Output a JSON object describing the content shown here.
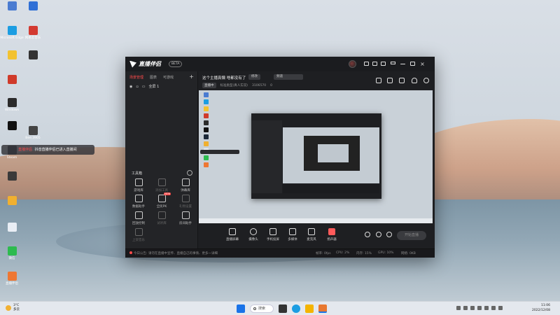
{
  "desktop": {
    "icons": [
      {
        "label": "",
        "color": "#4a7bd1"
      },
      {
        "label": "",
        "color": "#2f6fd6"
      },
      {
        "label": "Microsoft Edge",
        "color": "#1b9de2"
      },
      {
        "label": "网易云音乐",
        "color": "#d33a31"
      },
      {
        "label": "",
        "color": "#f2c230"
      },
      {
        "label": "",
        "color": "#333333"
      },
      {
        "label": "",
        "color": "#d03a2a"
      },
      {
        "label": "Windows",
        "color": "#2b2b2b"
      },
      {
        "label": "",
        "color": "#111111"
      },
      {
        "label": "Bee.3905",
        "color": "#444444"
      },
      {
        "label": "Steam",
        "color": "#1b2838"
      },
      {
        "label": "",
        "color": "#3a3a3a"
      },
      {
        "label": "",
        "color": "#f0b030"
      },
      {
        "label": "",
        "color": "#e9eef5"
      },
      {
        "label": "微信",
        "color": "#2dbb4f"
      },
      {
        "label": "直播伴侣",
        "color": "#ee7733"
      }
    ],
    "notification": {
      "app": "直播伴侣",
      "text": "抖音直播伴侣已进入直播间"
    }
  },
  "app": {
    "name": "直播伴侣",
    "beta_label": "BETA",
    "left_panel": {
      "tabs": [
        "场景管理",
        "图表",
        "可游戏"
      ],
      "add_label": "+",
      "scene": {
        "visible_icon": "eye-icon",
        "lock_icon": "lock-icon",
        "label": "全屏 1"
      },
      "toolbox_title": "工具箱",
      "tools": [
        {
          "label": "游戏库",
          "dim": false
        },
        {
          "label": "添加工具",
          "dim": true
        },
        {
          "label": "弹幕库",
          "dim": false
        },
        {
          "label": "数据助手",
          "dim": false
        },
        {
          "label": "全民PK",
          "dim": false,
          "badge": "NEW"
        },
        {
          "label": "礼物设置",
          "dim": true
        },
        {
          "label": "回放控制",
          "dim": false
        },
        {
          "label": "试听库",
          "dim": true
        },
        {
          "label": "房间助手",
          "dim": false
        },
        {
          "label": "上架音乐",
          "dim": true
        }
      ]
    },
    "info": {
      "title": "这个主播真懒 啥都没有了",
      "chip1": "修改",
      "chip2": "频道",
      "category": "直播中",
      "subline": "标准类型(真人实况)",
      "viewer_id": "3106570",
      "likes": "0"
    },
    "controls": [
      {
        "label": "直播屏幕",
        "icon": "screen-icon"
      },
      {
        "label": "摄像头",
        "icon": "camera-icon"
      },
      {
        "label": "手机投屏",
        "icon": "phone-icon"
      },
      {
        "label": "多媒体",
        "icon": "media-icon"
      },
      {
        "label": "麦克风",
        "icon": "mic-icon"
      },
      {
        "label": "扬声器",
        "icon": "speaker-icon"
      }
    ],
    "go_live_label": "开始直播",
    "status": {
      "message": "今日公告: 请勿在直播中宣传、直播自己的事情、更多一详细",
      "stats": [
        "帧率: 0fps",
        "CPU: 2%",
        "内存: 15%",
        "GPU: 10%",
        "网络: 0KB"
      ]
    }
  },
  "taskbar": {
    "weather": {
      "temp": "3°C",
      "desc": "多云"
    },
    "search_label": "搜索",
    "apps": [
      {
        "name": "start-icon",
        "color": "#1a73e8"
      },
      {
        "name": "file-explorer-icon",
        "color": "#f4b400"
      },
      {
        "name": "edge-icon",
        "color": "#1b9de2"
      },
      {
        "name": "store-icon",
        "color": "#5a5a5a"
      },
      {
        "name": "live-assistant-icon",
        "color": "#e87830"
      }
    ],
    "time": "11:06",
    "date": "2022/12/08"
  }
}
